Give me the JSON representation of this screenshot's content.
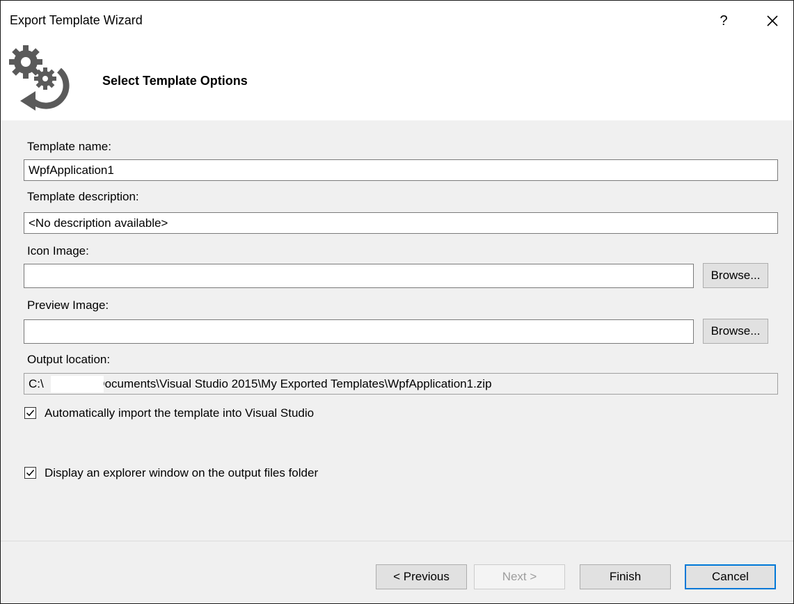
{
  "window": {
    "title": "Export Template Wizard",
    "help_label": "?"
  },
  "header": {
    "title": "Select Template Options"
  },
  "form": {
    "template_name_label": "Template name:",
    "template_name_value": "WpfApplication1",
    "template_description_label": "Template description:",
    "template_description_value": "<No description available>",
    "icon_image_label": "Icon Image:",
    "icon_image_value": "",
    "preview_image_label": "Preview Image:",
    "preview_image_value": "",
    "browse_label": "Browse...",
    "output_location_label": "Output location:",
    "output_location_value": "C:\\               \\Documents\\Visual Studio 2015\\My Exported Templates\\WpfApplication1.zip",
    "auto_import_label": "Automatically import the template into Visual Studio",
    "auto_import_checked": true,
    "display_explorer_label": "Display an explorer window on the output files folder",
    "display_explorer_checked": true
  },
  "footer": {
    "previous_label": "< Previous",
    "next_label": "Next >",
    "finish_label": "Finish",
    "cancel_label": "Cancel"
  },
  "colors": {
    "accent": "#0078d7",
    "window_bg": "#f0f0f0",
    "header_bg": "#ffffff",
    "icon_gray": "#5a5a5a"
  }
}
